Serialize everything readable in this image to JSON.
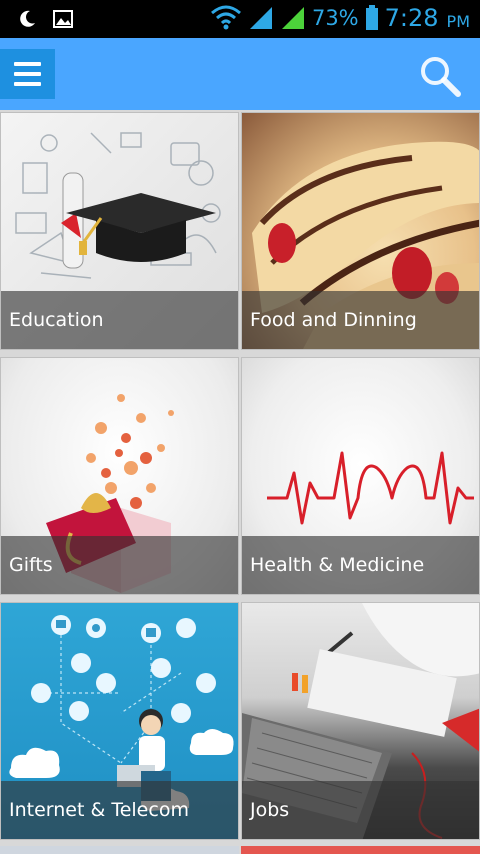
{
  "status_bar": {
    "battery_percent": "73%",
    "time": "7:28",
    "ampm": "PM"
  },
  "app_bar": {
    "menu_icon": "hamburger-menu-icon",
    "search_icon": "search-icon"
  },
  "categories": [
    {
      "label": "Education"
    },
    {
      "label": "Food and Dinning"
    },
    {
      "label": "Gifts"
    },
    {
      "label": "Health & Medicine"
    },
    {
      "label": "Internet & Telecom"
    },
    {
      "label": "Jobs"
    }
  ],
  "colors": {
    "app_bar": "#4aa6ff",
    "menu_button": "#1e90e0",
    "status_accent": "#2ea8e6"
  }
}
